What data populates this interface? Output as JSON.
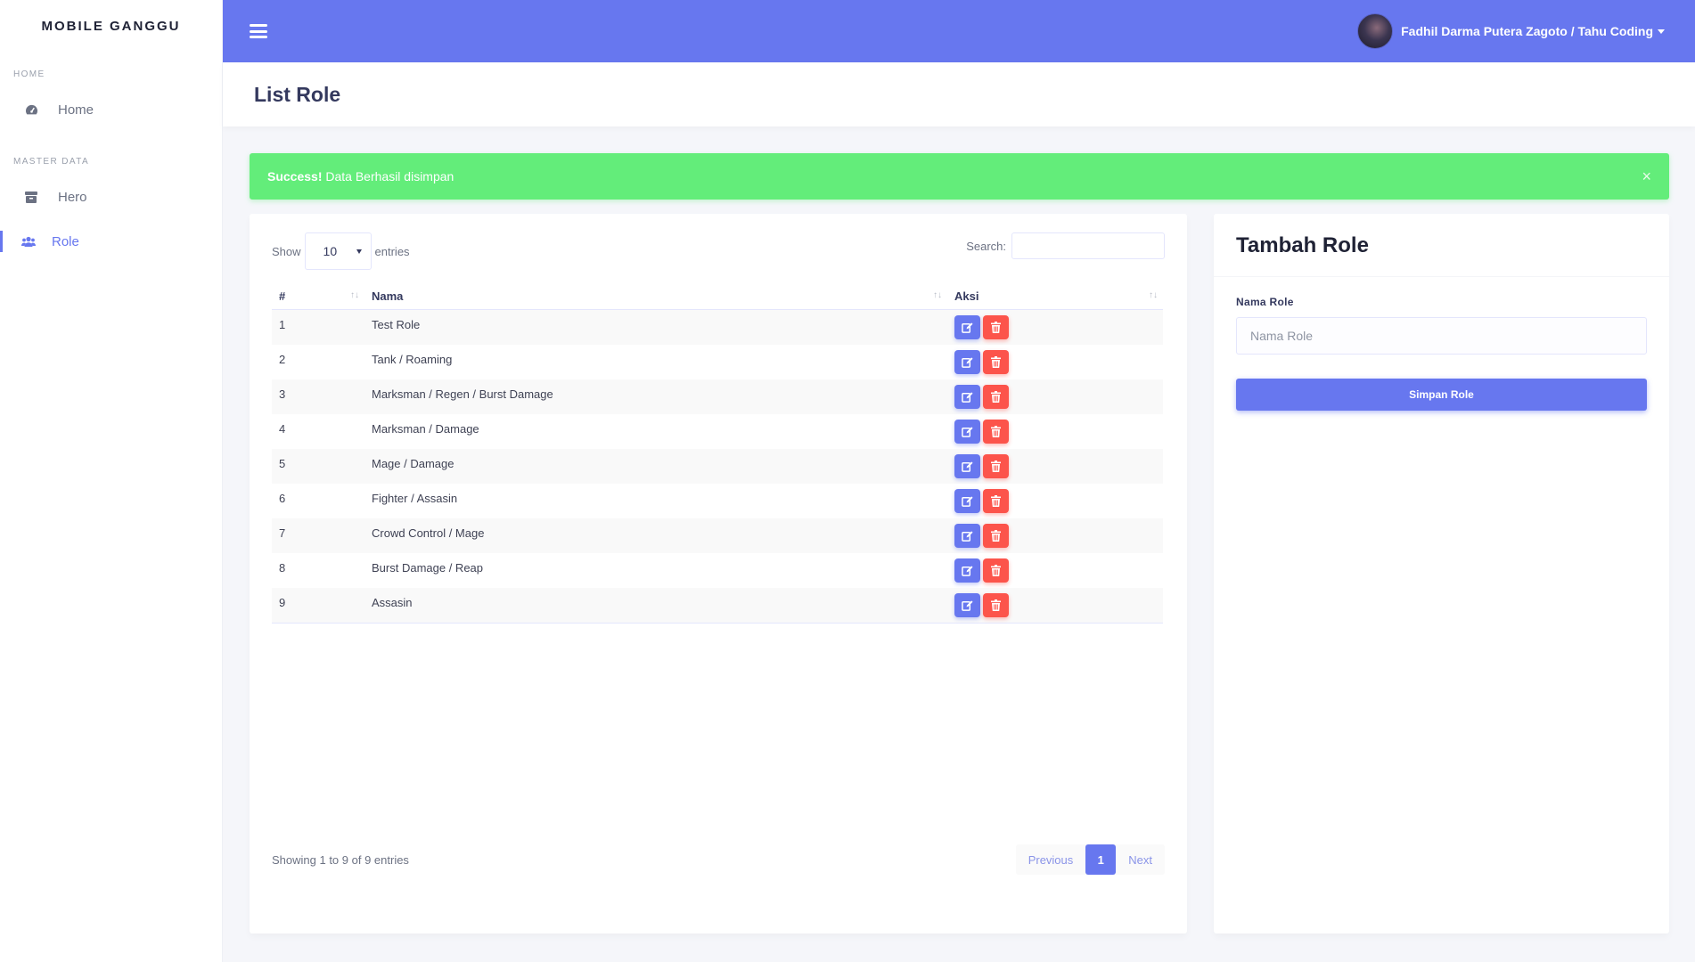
{
  "sidebar": {
    "brand": "MOBILE GANGGU",
    "sections": [
      {
        "heading": "HOME"
      },
      {
        "heading": "MASTER DATA"
      }
    ],
    "items": [
      {
        "label": "Home",
        "icon": "dashboard-icon"
      },
      {
        "label": "Hero",
        "icon": "archive-icon"
      },
      {
        "label": "Role",
        "icon": "users-icon",
        "active": true
      }
    ]
  },
  "topbar": {
    "user_name": "Fadhil Darma Putera Zagoto / Tahu Coding"
  },
  "page": {
    "title": "List Role"
  },
  "alert": {
    "strong": "Success!",
    "message": " Data Berhasil disimpan",
    "close": "×"
  },
  "table": {
    "show_label": "Show",
    "entries_value": "10",
    "entries_label": "entries",
    "search_label": "Search:",
    "columns": [
      "#",
      "Nama",
      "Aksi"
    ],
    "rows": [
      {
        "no": "1",
        "nama": "Test Role"
      },
      {
        "no": "2",
        "nama": "Tank / Roaming"
      },
      {
        "no": "3",
        "nama": "Marksman / Regen / Burst Damage"
      },
      {
        "no": "4",
        "nama": "Marksman / Damage"
      },
      {
        "no": "5",
        "nama": "Mage / Damage"
      },
      {
        "no": "6",
        "nama": "Fighter / Assasin"
      },
      {
        "no": "7",
        "nama": "Crowd Control / Mage"
      },
      {
        "no": "8",
        "nama": "Burst Damage / Reap"
      },
      {
        "no": "9",
        "nama": "Assasin"
      }
    ],
    "info": "Showing 1 to 9 of 9 entries",
    "pagination": {
      "previous": "Previous",
      "current": "1",
      "next": "Next"
    }
  },
  "form": {
    "title": "Tambah Role",
    "label": "Nama Role",
    "placeholder": "Nama Role",
    "submit": "Simpan Role"
  },
  "colors": {
    "primary": "#6777ef",
    "success": "#63ed7a",
    "danger": "#fc544b"
  }
}
